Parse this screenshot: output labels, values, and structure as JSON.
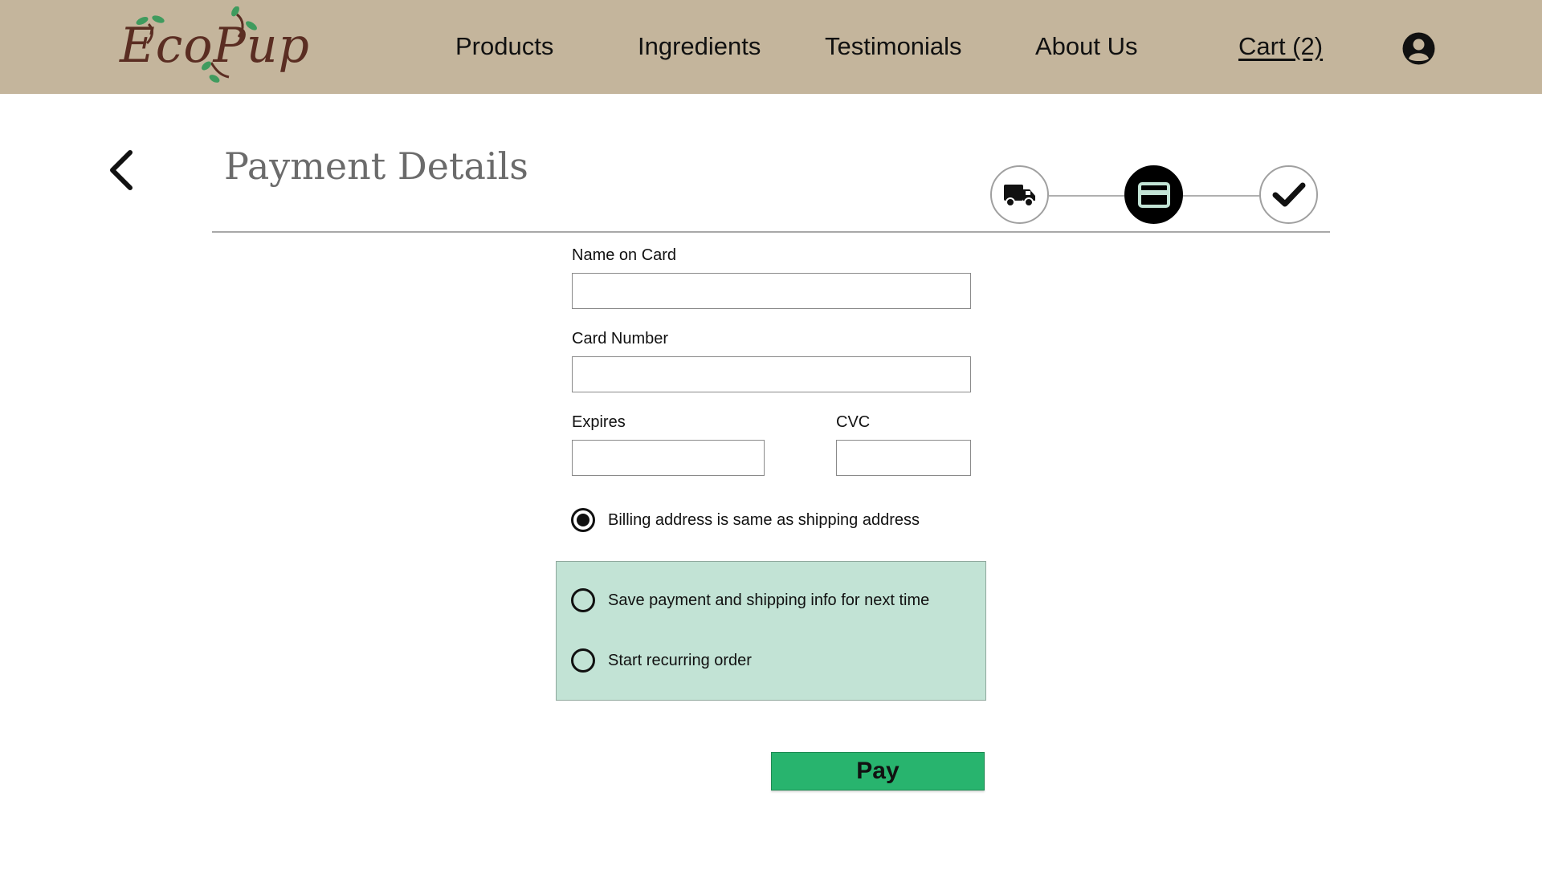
{
  "brand": {
    "logo_text": "EcoPup"
  },
  "nav": {
    "products": "Products",
    "ingredients": "Ingredients",
    "testimonials": "Testimonials",
    "about": "About Us",
    "cart": "Cart (2)"
  },
  "page": {
    "title": "Payment Details"
  },
  "stepper": {
    "steps": [
      {
        "icon": "truck-icon",
        "state": "inactive"
      },
      {
        "icon": "credit-card-icon",
        "state": "active"
      },
      {
        "icon": "checkmark-icon",
        "state": "inactive"
      }
    ]
  },
  "form": {
    "name_label": "Name on Card",
    "name_value": "",
    "card_label": "Card Number",
    "card_value": "",
    "expires_label": "Expires",
    "expires_value": "",
    "cvc_label": "CVC",
    "cvc_value": "",
    "billing_same_label": "Billing address is same as shipping address",
    "billing_same_selected": true,
    "save_info_label": "Save payment and shipping info for next time",
    "save_info_selected": false,
    "recurring_label": "Start recurring order",
    "recurring_selected": false,
    "pay_label": "Pay"
  },
  "colors": {
    "header_bg": "#c4b59c",
    "logo_color": "#5a2d22",
    "leaf_green": "#3f9b5e",
    "options_bg": "#c2e3d5",
    "pay_button": "#28b46e"
  }
}
